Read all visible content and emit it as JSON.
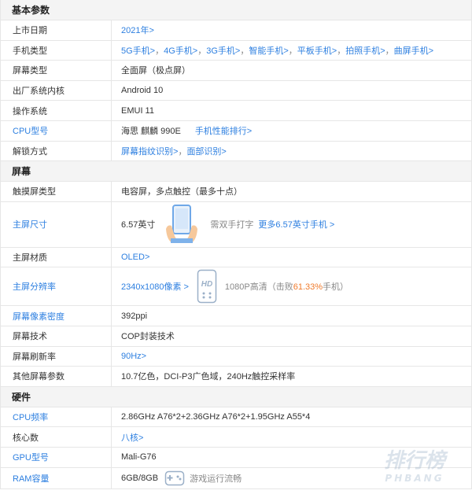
{
  "sections": {
    "basic": "基本参数",
    "screen": "屏幕",
    "hardware": "硬件"
  },
  "basic": {
    "launch_date": {
      "label": "上市日期",
      "value": "2021年>"
    },
    "phone_type": {
      "label": "手机类型",
      "links": [
        "5G手机>",
        "4G手机>",
        "3G手机>",
        "智能手机>",
        "平板手机>",
        "拍照手机>",
        "曲屏手机>"
      ]
    },
    "screen_type": {
      "label": "屏幕类型",
      "value": "全面屏（极点屏）"
    },
    "os": {
      "label": "出厂系统内核",
      "value": "Android 10"
    },
    "ui": {
      "label": "操作系统",
      "value": "EMUI 11"
    },
    "cpu": {
      "label": "CPU型号",
      "value": "海思 麒麟 990E",
      "link": "手机性能排行>"
    },
    "unlock": {
      "label": "解锁方式",
      "links": [
        "屏幕指纹识别>",
        "面部识别>"
      ]
    }
  },
  "screen": {
    "touch": {
      "label": "触摸屏类型",
      "value": "电容屏，多点触控（最多十点）"
    },
    "size": {
      "label": "主屏尺寸",
      "value": "6.57英寸",
      "note": "需双手打字",
      "link": "更多6.57英寸手机 >"
    },
    "material": {
      "label": "主屏材质",
      "value": "OLED>"
    },
    "resolution": {
      "label": "主屏分辨率",
      "value": "2340x1080像素 >",
      "icon_text": "HD",
      "note_prefix": "1080P高清（击败",
      "note_pct": "61.33%",
      "note_suffix": "手机）"
    },
    "ppi": {
      "label": "屏幕像素密度",
      "value": "392ppi"
    },
    "tech": {
      "label": "屏幕技术",
      "value": "COP封装技术"
    },
    "refresh": {
      "label": "屏幕刷新率",
      "value": "90Hz>"
    },
    "other": {
      "label": "其他屏幕参数",
      "value": "10.7亿色，DCI-P3广色域，240Hz触控采样率"
    }
  },
  "hardware": {
    "cpu_freq": {
      "label": "CPU频率",
      "value": "2.86GHz A76*2+2.36GHz A76*2+1.95GHz A55*4"
    },
    "cores": {
      "label": "核心数",
      "value": "八核>"
    },
    "gpu": {
      "label": "GPU型号",
      "value": "Mali-G76"
    },
    "ram": {
      "label": "RAM容量",
      "value": "6GB/8GB",
      "note": "游戏运行流畅"
    }
  },
  "watermark": {
    "main": "排行榜",
    "sub": "PHBANG"
  },
  "colors": {
    "link": "#2d7fe0",
    "highlight": "#f07a2b",
    "section_bg": "#f4f4f4",
    "border": "#e6e6e6"
  }
}
